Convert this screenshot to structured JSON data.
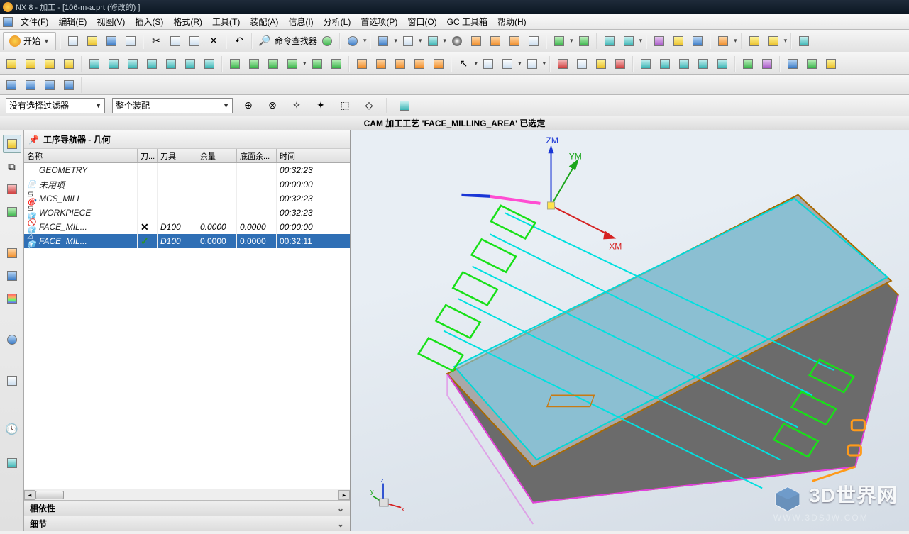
{
  "title": "NX 8 - 加工 - [106-m-a.prt  (修改的)  ]",
  "menu": {
    "file": "文件(F)",
    "edit": "编辑(E)",
    "view": "视图(V)",
    "insert": "插入(S)",
    "format": "格式(R)",
    "tools": "工具(T)",
    "assembly": "装配(A)",
    "info": "信息(I)",
    "analyze": "分析(L)",
    "pref": "首选项(P)",
    "window": "窗口(O)",
    "gc": "GC 工具箱",
    "help": "帮助(H)"
  },
  "toolbar": {
    "start": "开始",
    "cmd_finder_label": "命令查找器"
  },
  "filter": {
    "no_filter": "没有选择过滤器",
    "whole_asm": "整个装配"
  },
  "status": "CAM 加工工艺 'FACE_MILLING_AREA' 已选定",
  "navigator": {
    "title": "工序导航器 - 几何",
    "cols": {
      "name": "名称",
      "m": "刀...",
      "tool": "刀具",
      "rem": "余量",
      "bot": "底面余...",
      "time": "时间"
    },
    "rows": [
      {
        "name": "GEOMETRY",
        "m": "",
        "tool": "",
        "rem": "",
        "bot": "",
        "time": "00:32:23",
        "indent": 0,
        "sel": false
      },
      {
        "name": "未用项",
        "m": "",
        "tool": "",
        "rem": "",
        "bot": "",
        "time": "00:00:00",
        "indent": 1,
        "sel": false
      },
      {
        "name": "MCS_MILL",
        "m": "",
        "tool": "",
        "rem": "",
        "bot": "",
        "time": "00:32:23",
        "indent": 1,
        "sel": false
      },
      {
        "name": "WORKPIECE",
        "m": "",
        "tool": "",
        "rem": "",
        "bot": "",
        "time": "00:32:23",
        "indent": 2,
        "sel": false
      },
      {
        "name": "FACE_MIL...",
        "m": "✕",
        "tool": "D100",
        "rem": "0.0000",
        "bot": "0.0000",
        "time": "00:00:00",
        "indent": 3,
        "sel": false
      },
      {
        "name": "FACE_MIL...",
        "m": "✓",
        "tool": "D100",
        "rem": "0.0000",
        "bot": "0.0000",
        "time": "00:32:11",
        "indent": 3,
        "sel": true
      }
    ],
    "accordion1": "相依性",
    "accordion2": "细节"
  },
  "axes": {
    "zm": "ZM",
    "ym": "YM",
    "xm": "XM",
    "x": "x",
    "y": "y",
    "z": "z"
  },
  "watermark": {
    "t1": "3D世界网",
    "t2": "WWW.3DSJW.COM"
  }
}
